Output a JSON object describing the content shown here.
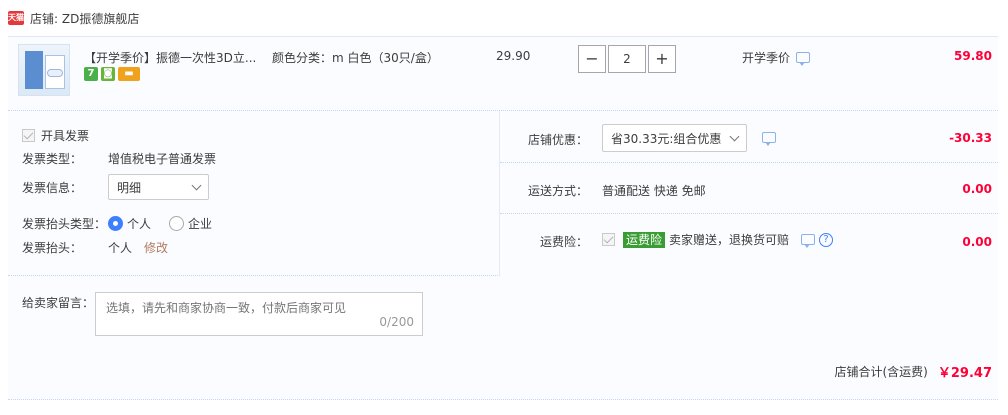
{
  "shop": {
    "icon": "tmall-logo",
    "logo_text": "天猫",
    "label": "店铺: ZD振德旗舰店"
  },
  "item": {
    "title": "【开学季价】振德一次性3D立...",
    "sku": "颜色分类：m 白色（30只/盒）",
    "unit_price": "29.90",
    "quantity": "2",
    "minus": "−",
    "plus": "+",
    "promotion": "开学季价",
    "subtotal": "59.80",
    "badges": [
      "7",
      "◙",
      "▬"
    ]
  },
  "invoice": {
    "checkbox_label": "开具发票",
    "type_label": "发票类型：",
    "type_value": "增值税电子普通发票",
    "info_label": "发票信息：",
    "info_value": "明细",
    "title_type_label": "发票抬头类型：",
    "option_personal": "个人",
    "option_company": "企业",
    "title_label": "发票抬头：",
    "title_value": "个人",
    "edit": "修改"
  },
  "message": {
    "label": "给卖家留言：",
    "placeholder": "选填，请先和商家协商一致，付款后商家可见",
    "count": "0/200"
  },
  "discount": {
    "label": "店铺优惠：",
    "selected": "省30.33元:组合优惠",
    "amount": "-30.33"
  },
  "shipping": {
    "label": "运送方式：",
    "value": "普通配送 快递 免邮",
    "amount": "0.00"
  },
  "insurance": {
    "label": "运费险：",
    "tag": "运费险",
    "text": "卖家赠送，退换货可赔",
    "help": "?",
    "amount": "0.00"
  },
  "summary": {
    "label": "店铺合计(含运费)",
    "amount": "￥29.47"
  },
  "colors": {
    "price_red": "#ff0036",
    "accent_blue": "#3d7fff",
    "panel_bg": "#fbfcff",
    "insure_green": "#3a9d33"
  }
}
